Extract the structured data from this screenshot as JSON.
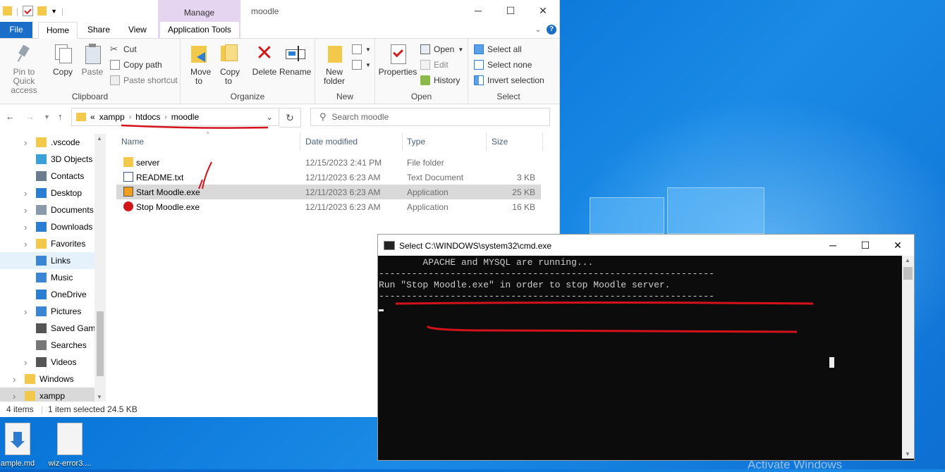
{
  "explorer": {
    "title": "moodle",
    "context_group": "Manage",
    "tabs": {
      "file": "File",
      "home": "Home",
      "share": "Share",
      "view": "View",
      "app_tools": "Application Tools"
    },
    "ribbon": {
      "clipboard": {
        "label": "Clipboard",
        "pin": "Pin to Quick access",
        "copy": "Copy",
        "paste": "Paste",
        "cut": "Cut",
        "copy_path": "Copy path",
        "paste_shortcut": "Paste shortcut"
      },
      "organize": {
        "label": "Organize",
        "move_to": "Move to",
        "copy_to": "Copy to",
        "delete": "Delete",
        "rename": "Rename"
      },
      "new": {
        "label": "New",
        "new_folder": "New folder"
      },
      "open": {
        "label": "Open",
        "properties": "Properties",
        "open": "Open",
        "edit": "Edit",
        "history": "History"
      },
      "select": {
        "label": "Select",
        "select_all": "Select all",
        "select_none": "Select none",
        "invert": "Invert selection"
      }
    },
    "address": {
      "prefix": "«",
      "crumbs": [
        "xampp",
        "htdocs",
        "moodle"
      ]
    },
    "search_placeholder": "Search moodle",
    "nav_items": [
      {
        "label": ".vscode",
        "icon": "folder-icon"
      },
      {
        "label": "3D Objects",
        "icon": "cube-icon"
      },
      {
        "label": "Contacts",
        "icon": "contacts-icon"
      },
      {
        "label": "Desktop",
        "icon": "desktop-icon"
      },
      {
        "label": "Documents",
        "icon": "documents-icon"
      },
      {
        "label": "Downloads",
        "icon": "download-icon"
      },
      {
        "label": "Favorites",
        "icon": "star-icon"
      },
      {
        "label": "Links",
        "icon": "link-icon"
      },
      {
        "label": "Music",
        "icon": "music-icon"
      },
      {
        "label": "OneDrive",
        "icon": "cloud-icon"
      },
      {
        "label": "Pictures",
        "icon": "pictures-icon"
      },
      {
        "label": "Saved Games",
        "icon": "games-icon"
      },
      {
        "label": "Searches",
        "icon": "search-icon"
      },
      {
        "label": "Videos",
        "icon": "videos-icon"
      },
      {
        "label": "Windows",
        "icon": "folder-icon"
      },
      {
        "label": "xampp",
        "icon": "folder-icon"
      }
    ],
    "columns": {
      "name": "Name",
      "date": "Date modified",
      "type": "Type",
      "size": "Size"
    },
    "files": [
      {
        "name": "server",
        "date": "12/15/2023 2:41 PM",
        "type": "File folder",
        "size": ""
      },
      {
        "name": "README.txt",
        "date": "12/11/2023 6:23 AM",
        "type": "Text Document",
        "size": "3 KB"
      },
      {
        "name": "Start Moodle.exe",
        "date": "12/11/2023 6:23 AM",
        "type": "Application",
        "size": "25 KB"
      },
      {
        "name": "Stop Moodle.exe",
        "date": "12/11/2023 6:23 AM",
        "type": "Application",
        "size": "16 KB"
      }
    ],
    "status": {
      "items": "4 items",
      "selected": "1 item selected  24.5 KB"
    }
  },
  "cmd": {
    "title": "Select C:\\WINDOWS\\system32\\cmd.exe",
    "lines": [
      "        APACHE and MYSQL are running...",
      "-------------------------------------------------------------",
      "Run \"Stop Moodle.exe\" in order to stop Moodle server.",
      "-------------------------------------------------------------"
    ]
  },
  "desktop": {
    "icons": [
      "ample.md",
      "wiz-error3...."
    ],
    "watermark": "Activate Windows"
  },
  "colors": {
    "accent": "#1a6ec8",
    "annotation": "#d4121c",
    "selection": "#d9d9d9"
  }
}
